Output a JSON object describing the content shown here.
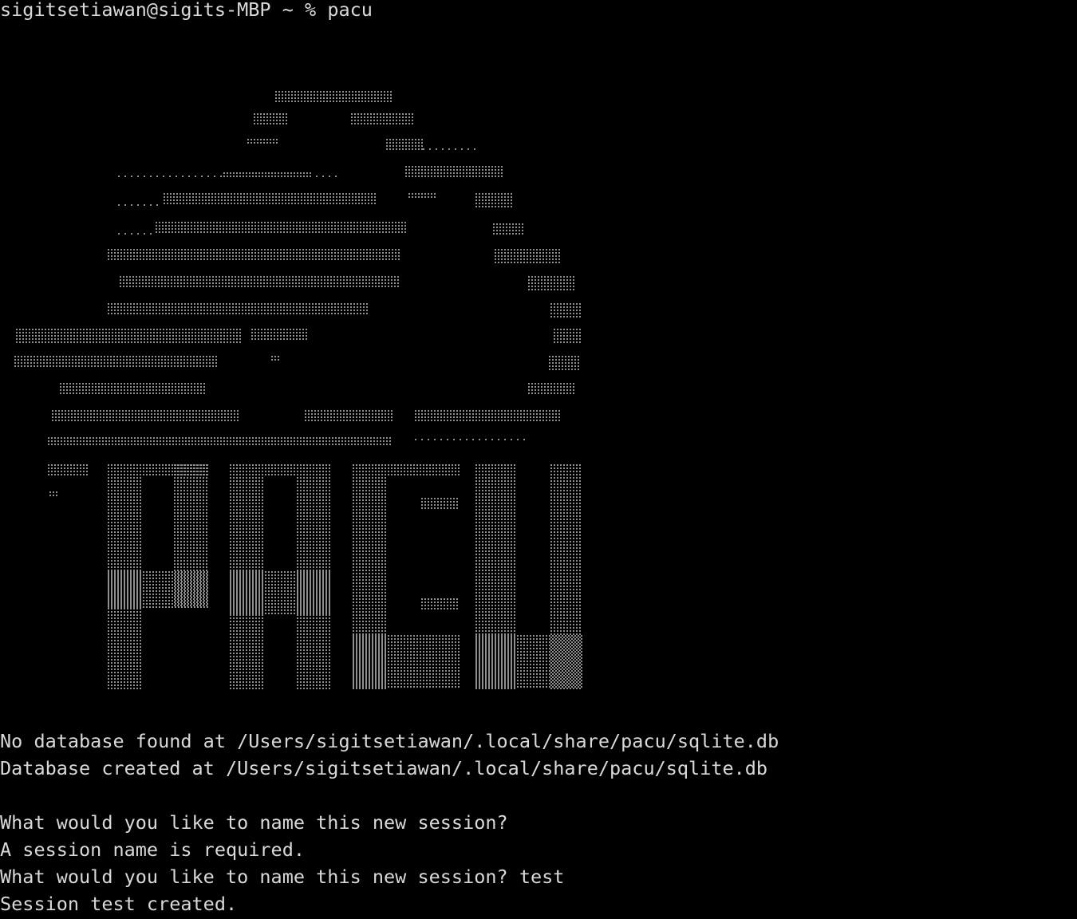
{
  "terminal": {
    "prompt_user_host": "sigitsetiawan@sigits-MBP",
    "prompt_dir": "~",
    "prompt_symbol": "%",
    "command": "pacu",
    "foreground": "#d9d9d9",
    "background": "#000000"
  },
  "logo": {
    "caption": "",
    "word": "PACU"
  },
  "output": {
    "db_not_found": "No database found at /Users/sigitsetiawan/.local/share/pacu/sqlite.db",
    "db_created": "Database created at /Users/sigitsetiawan/.local/share/pacu/sqlite.db",
    "prompt_session_1": "What would you like to name this new session?",
    "session_required": "A session name is required.",
    "prompt_session_2": "What would you like to name this new session? test",
    "session_created": "Session test created."
  }
}
